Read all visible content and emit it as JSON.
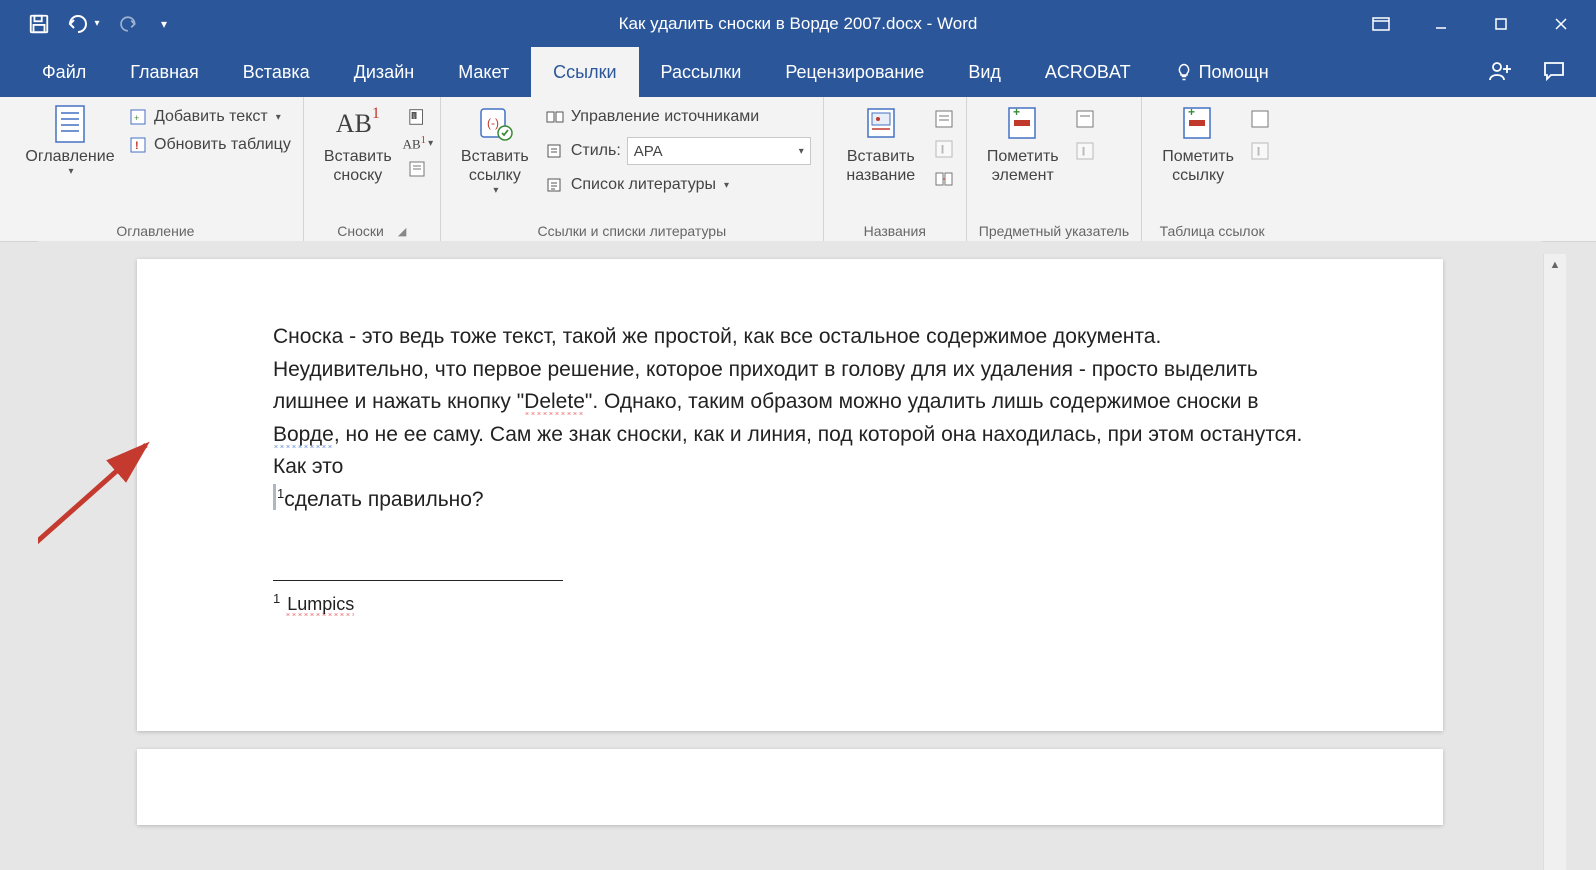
{
  "titlebar": {
    "document_title": "Как удалить сноски в Ворде 2007.docx - Word"
  },
  "tabs": {
    "file": "Файл",
    "home": "Главная",
    "insert": "Вставка",
    "design": "Дизайн",
    "layout": "Макет",
    "references": "Ссылки",
    "mailings": "Рассылки",
    "review": "Рецензирование",
    "view": "Вид",
    "acrobat": "ACROBAT",
    "tell_me": "Помощн"
  },
  "ribbon": {
    "toc": {
      "button": "Оглавление",
      "add_text": "Добавить текст",
      "update_table": "Обновить таблицу",
      "group": "Оглавление"
    },
    "footnotes": {
      "insert": "Вставить\nсноску",
      "ab": "AB",
      "group": "Сноски"
    },
    "citations": {
      "insert_link": "Вставить\nссылку",
      "manage_sources": "Управление источниками",
      "style_label": "Стиль:",
      "style_value": "APA",
      "bibliography": "Список литературы",
      "group": "Ссылки и списки литературы"
    },
    "captions": {
      "insert_caption": "Вставить\nназвание",
      "group": "Названия"
    },
    "index": {
      "mark_entry": "Пометить\nэлемент",
      "group": "Предметный указатель"
    },
    "toa": {
      "mark_citation": "Пометить\nссылку",
      "group": "Таблица ссылок"
    }
  },
  "document": {
    "paragraph_plain": "Сноска - это ведь тоже текст, такой же простой, как все остальное содержимое документа. Неудивительно, что первое решение, которое приходит в голову для их удаления - просто выделить лишнее и нажать кнопку \"Delete\". Однако, таким образом можно удалить лишь содержимое сноски в Ворде, но не ее саму. Сам же знак сноски, как и линия, под которой она находилась, при этом останутся. Как это сделать правильно?",
    "p_frag1": "Сноска - это ведь тоже текст, такой же простой, как все остальное содержимое документа. Неудивительно, что первое решение, которое приходит в голову для их удаления - просто выделить лишнее и нажать кнопку \"",
    "p_delete": "Delete",
    "p_frag2": "\". Однако, таким образом можно удалить лишь содержимое сноски в ",
    "p_vorde": "Ворде",
    "p_frag3": ", но не ее саму. Сам же знак сноски, как и линия, под которой она находилась, при этом останутся. Как это ",
    "p_ref": "1",
    "p_frag4": "сделать правильно?",
    "footnote_num": "1",
    "footnote_text": "Lumpics"
  }
}
